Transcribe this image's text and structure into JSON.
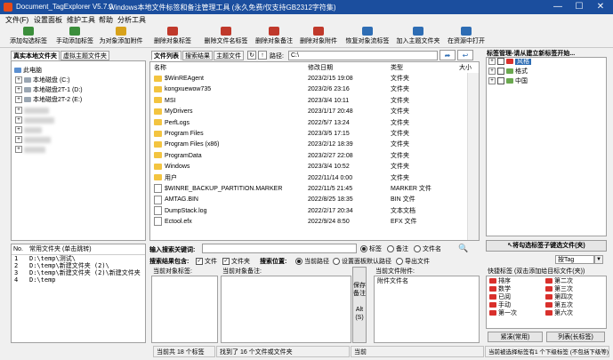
{
  "window": {
    "app_title": "Document_TagExplorer  V5.7.0",
    "subtitle": "Windows本地文件标签和备注管理工具 (永久免费/仅支持GB2312字符集)",
    "minimize": "—",
    "maximize": "☐",
    "close": "✕"
  },
  "menu": [
    "文件(F)",
    "设置面板",
    "维护工具",
    "帮助",
    "分析工具"
  ],
  "toolbar": [
    {
      "label": "添加勾选标签",
      "color": "#3b8e3b"
    },
    {
      "label": "手动添加标签",
      "color": "#3b8e3b"
    },
    {
      "label": "为对象添加附件",
      "color": "#d8a21b"
    },
    {
      "label": "删除对象标签",
      "color": "#c0392b"
    },
    {
      "label": "删除文件名标签",
      "color": "#c0392b"
    },
    {
      "label": "删除对象备注",
      "color": "#c0392b"
    },
    {
      "label": "删除对象附件",
      "color": "#c0392b"
    },
    {
      "label": "恢复对象流标签",
      "color": "#2e6db4"
    },
    {
      "label": "加入主题文件夹",
      "color": "#2e6db4"
    },
    {
      "label": "在资源中打开",
      "color": "#2e6db4"
    }
  ],
  "left_tabs": [
    "真实本地文件夹",
    "虚拟主题文件夹"
  ],
  "tree": {
    "root": "此电脑",
    "drives": [
      "本地磁盘 (C:)",
      "本地磁盘2T-1 (D:)",
      "本地磁盘2T-2 (E:)"
    ],
    "blurred_count": 5
  },
  "center_tabs": [
    "文件列表",
    "搜索结果",
    "主题文件"
  ],
  "path": {
    "label": "路径:",
    "value": "C:\\"
  },
  "file_columns": {
    "name": "名称",
    "date": "修改日期",
    "type": "类型",
    "size": "大小"
  },
  "files": [
    {
      "name": "$WinREAgent",
      "date": "2023/2/15 19:08",
      "type": "文件夹",
      "kind": "folder"
    },
    {
      "name": "kongxuewow735",
      "date": "2023/2/6 23:16",
      "type": "文件夹",
      "kind": "folder"
    },
    {
      "name": "MSI",
      "date": "2023/3/4 10:11",
      "type": "文件夹",
      "kind": "folder"
    },
    {
      "name": "MyDrivers",
      "date": "2023/1/17 20:48",
      "type": "文件夹",
      "kind": "folder"
    },
    {
      "name": "PerfLogs",
      "date": "2022/5/7 13:24",
      "type": "文件夹",
      "kind": "folder"
    },
    {
      "name": "Program Files",
      "date": "2023/3/5 17:15",
      "type": "文件夹",
      "kind": "folder"
    },
    {
      "name": "Program Files (x86)",
      "date": "2023/2/12 18:39",
      "type": "文件夹",
      "kind": "folder"
    },
    {
      "name": "ProgramData",
      "date": "2023/2/27 22:08",
      "type": "文件夹",
      "kind": "folder"
    },
    {
      "name": "Windows",
      "date": "2023/3/4 10:52",
      "type": "文件夹",
      "kind": "folder"
    },
    {
      "name": "用户",
      "date": "2022/11/14 0:00",
      "type": "文件夹",
      "kind": "folder"
    },
    {
      "name": "$WINRE_BACKUP_PARTITION.MARKER",
      "date": "2022/11/5 21:45",
      "type": "MARKER 文件",
      "kind": "file"
    },
    {
      "name": "AMTAG.BIN",
      "date": "2022/8/25 18:35",
      "type": "BIN 文件",
      "kind": "file"
    },
    {
      "name": "DumpStack.log",
      "date": "2022/2/17 20:34",
      "type": "文本文档",
      "kind": "file"
    },
    {
      "name": "Ectool.efx",
      "date": "2022/9/24 8:50",
      "type": "EFX 文件",
      "kind": "file"
    }
  ],
  "common": {
    "col_no": "No.",
    "col_name": "常用文件夹 (单击跳转)",
    "items": [
      {
        "no": "1",
        "path": "D:\\temp\\测试\\"
      },
      {
        "no": "2",
        "path": "D:\\temp\\新建文件夹 (2)\\"
      },
      {
        "no": "3",
        "path": "D:\\temp\\新建文件夹 (2)\\新建文件夹"
      },
      {
        "no": "4",
        "path": "D:\\temp"
      }
    ]
  },
  "search": {
    "keyword_label": "输入搜索关键词:",
    "mode_options": [
      "标签",
      "备注",
      "文件名"
    ],
    "include_label": "搜索结果包含:",
    "include_file": "文件",
    "include_folder": "文件夹",
    "location_label": "搜索位置:",
    "location_options": [
      "当前路径",
      "设置面板默认路径",
      "导出文件"
    ],
    "icon": "🔍"
  },
  "bottom_panels": {
    "current_tags": "当前对象标签:",
    "current_notes": "当前对象备注:",
    "save_note": "保存备注",
    "save_note_shortcut": "Alt(S)",
    "current_attachments": "当前文件附件:",
    "attachment_label": "附件文件名"
  },
  "tag_mgmt": {
    "header": "标签管理-请从建立新标签开始...",
    "items": [
      {
        "label": "风格",
        "level": 0,
        "selected": true
      },
      {
        "label": "格式",
        "level": 0,
        "selected": false
      },
      {
        "label": "中国",
        "level": 0,
        "selected": false
      }
    ],
    "add_to_tags": "将勾选标签子键选文件(夹)",
    "tag_dropdown": "按Tag",
    "quick_header": "快捷标签 (双击添加给目标文件(夹))",
    "quick_tags": [
      "排序",
      "第二次",
      "数学",
      "第三次",
      "已阅",
      "第四次",
      "手动",
      "第五次",
      "第一次",
      "第六次"
    ],
    "compact_btn": "紧凑(常用)",
    "list_btn": "列表(长标签)"
  },
  "status": {
    "tags": "当前共 18 个标签",
    "found": "找到了 16 个文件或文件夹",
    "current": "当前",
    "selected": "当前被选择标签有1 个下级标签 (不包括下级等)"
  }
}
